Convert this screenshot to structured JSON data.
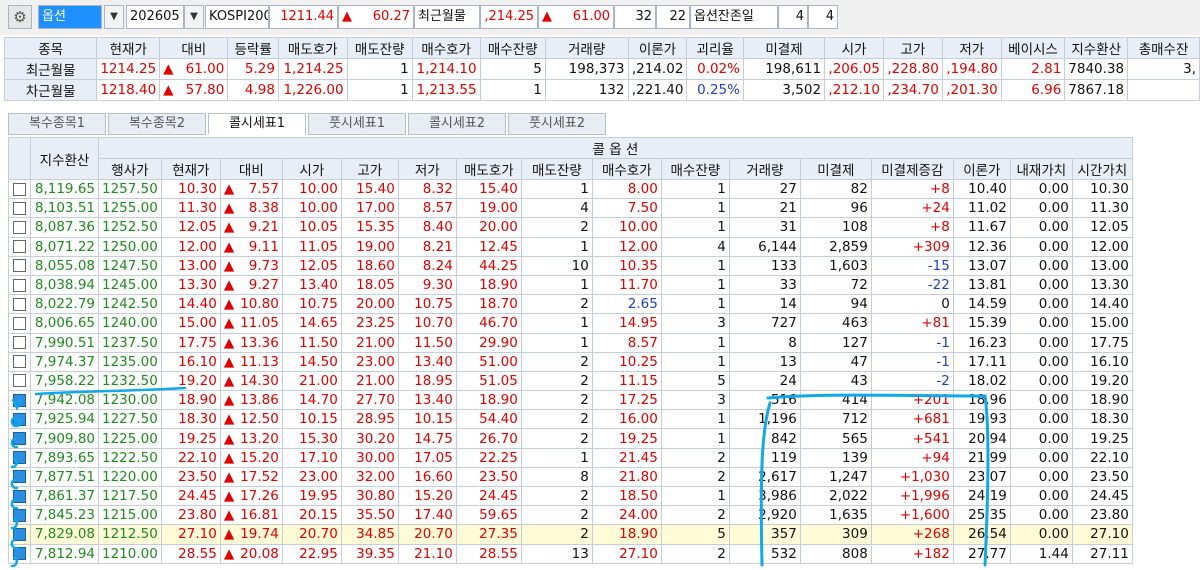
{
  "toolbar": {
    "option_type": "옵션",
    "expiry": "202605",
    "index_name": "KOSPI200",
    "index_price": "1211.44",
    "index_change": "60.27",
    "front_label": "최근월물",
    "front_price": ",214.25",
    "front_change": "61.00",
    "count_a": "32",
    "count_b": "22",
    "days_label": "옵션잔존일",
    "days_a": "4",
    "days_b": "4"
  },
  "futures": {
    "headers": [
      "종목",
      "현재가",
      "대비",
      "등락률",
      "매도호가",
      "매도잔량",
      "매수호가",
      "매수잔량",
      "거래량",
      "이론가",
      "괴리율",
      "미결제",
      "시가",
      "고가",
      "저가",
      "베이시스",
      "지수환산",
      "총매수잔"
    ],
    "rows": [
      {
        "name": "최근월물",
        "price": "1214.25",
        "change": "61.00",
        "rate": "5.29",
        "ask": "1,214.25",
        "ask_qty": "1",
        "bid": "1,214.10",
        "bid_qty": "5",
        "volume": "198,373",
        "theory": ",214.02",
        "gap": "0.02%",
        "oi": "198,611",
        "open": ",206.05",
        "high": ",228.80",
        "low": ",194.80",
        "basis": "2.81",
        "idx": "7840.38",
        "total": "3,"
      },
      {
        "name": "차근월물",
        "price": "1218.40",
        "change": "57.80",
        "rate": "4.98",
        "ask": "1,226.00",
        "ask_qty": "1",
        "bid": "1,213.55",
        "bid_qty": "1",
        "volume": "132",
        "theory": ",221.40",
        "gap": "0.25%",
        "oi": "3,502",
        "open": ",212.10",
        "high": ",234.70",
        "low": ",201.30",
        "basis": "6.96",
        "idx": "7867.18",
        "total": ""
      }
    ]
  },
  "tabs": [
    "복수종목1",
    "복수종목2",
    "콜시세표1",
    "풋시세표1",
    "콜시세표2",
    "풋시세표2"
  ],
  "calls": {
    "group_title": "콜 옵 션",
    "headers": [
      "지수환산",
      "행사가",
      "현재가",
      "대비",
      "시가",
      "고가",
      "저가",
      "매도호가",
      "매도잔량",
      "매수호가",
      "매수잔량",
      "거래량",
      "미결제",
      "미결제증감",
      "이론가",
      "내재가치",
      "시간가치"
    ],
    "rows": [
      {
        "checked": false,
        "hl": false,
        "idx": "8,119.65",
        "strike": "1257.50",
        "price": "10.30",
        "chg": "7.57",
        "open": "10.00",
        "high": "15.40",
        "low": "8.32",
        "ask": "15.40",
        "askq": "1",
        "bid": "8.00",
        "bidq": "1",
        "vol": "27",
        "oi": "82",
        "oichg": "+8",
        "theory": "10.40",
        "intr": "0.00",
        "tv": "10.30"
      },
      {
        "checked": false,
        "hl": false,
        "idx": "8,103.51",
        "strike": "1255.00",
        "price": "11.30",
        "chg": "8.38",
        "open": "10.00",
        "high": "17.00",
        "low": "8.57",
        "ask": "19.00",
        "askq": "4",
        "bid": "7.50",
        "bidq": "1",
        "vol": "21",
        "oi": "96",
        "oichg": "+24",
        "theory": "11.02",
        "intr": "0.00",
        "tv": "11.30"
      },
      {
        "checked": false,
        "hl": false,
        "idx": "8,087.36",
        "strike": "1252.50",
        "price": "12.05",
        "chg": "9.21",
        "open": "10.05",
        "high": "15.35",
        "low": "8.40",
        "ask": "20.00",
        "askq": "2",
        "bid": "10.00",
        "bidq": "1",
        "vol": "31",
        "oi": "108",
        "oichg": "+8",
        "theory": "11.67",
        "intr": "0.00",
        "tv": "12.05"
      },
      {
        "checked": false,
        "hl": false,
        "idx": "8,071.22",
        "strike": "1250.00",
        "price": "12.00",
        "chg": "9.11",
        "open": "11.05",
        "high": "19.00",
        "low": "8.21",
        "ask": "12.45",
        "askq": "1",
        "bid": "12.00",
        "bidq": "4",
        "vol": "6,144",
        "oi": "2,859",
        "oichg": "+309",
        "theory": "12.36",
        "intr": "0.00",
        "tv": "12.00"
      },
      {
        "checked": false,
        "hl": false,
        "idx": "8,055.08",
        "strike": "1247.50",
        "price": "13.00",
        "chg": "9.73",
        "open": "12.05",
        "high": "18.60",
        "low": "8.24",
        "ask": "44.25",
        "askq": "10",
        "bid": "10.35",
        "bidq": "1",
        "vol": "133",
        "oi": "1,603",
        "oichg": "-15",
        "theory": "13.07",
        "intr": "0.00",
        "tv": "13.00"
      },
      {
        "checked": false,
        "hl": false,
        "idx": "8,038.94",
        "strike": "1245.00",
        "price": "13.30",
        "chg": "9.27",
        "open": "13.40",
        "high": "18.05",
        "low": "9.30",
        "ask": "18.90",
        "askq": "1",
        "bid": "11.70",
        "bidq": "1",
        "vol": "33",
        "oi": "72",
        "oichg": "-22",
        "theory": "13.81",
        "intr": "0.00",
        "tv": "13.30"
      },
      {
        "checked": false,
        "hl": false,
        "idx": "8,022.79",
        "strike": "1242.50",
        "price": "14.40",
        "chg": "10.80",
        "open": "10.75",
        "high": "20.00",
        "low": "10.75",
        "ask": "18.70",
        "askq": "2",
        "bid": "2.65",
        "bidq": "1",
        "vol": "14",
        "oi": "94",
        "oichg": "0",
        "theory": "14.59",
        "intr": "0.00",
        "tv": "14.40"
      },
      {
        "checked": false,
        "hl": false,
        "idx": "8,006.65",
        "strike": "1240.00",
        "price": "15.00",
        "chg": "11.05",
        "open": "14.65",
        "high": "23.25",
        "low": "10.70",
        "ask": "46.70",
        "askq": "1",
        "bid": "14.95",
        "bidq": "3",
        "vol": "727",
        "oi": "463",
        "oichg": "+81",
        "theory": "15.39",
        "intr": "0.00",
        "tv": "15.00"
      },
      {
        "checked": false,
        "hl": false,
        "idx": "7,990.51",
        "strike": "1237.50",
        "price": "17.75",
        "chg": "13.36",
        "open": "11.50",
        "high": "21.00",
        "low": "11.50",
        "ask": "29.90",
        "askq": "1",
        "bid": "8.57",
        "bidq": "1",
        "vol": "8",
        "oi": "127",
        "oichg": "-1",
        "theory": "16.23",
        "intr": "0.00",
        "tv": "17.75"
      },
      {
        "checked": false,
        "hl": false,
        "idx": "7,974.37",
        "strike": "1235.00",
        "price": "16.10",
        "chg": "11.13",
        "open": "14.50",
        "high": "23.00",
        "low": "13.40",
        "ask": "51.00",
        "askq": "2",
        "bid": "10.25",
        "bidq": "1",
        "vol": "13",
        "oi": "47",
        "oichg": "-1",
        "theory": "17.11",
        "intr": "0.00",
        "tv": "16.10"
      },
      {
        "checked": false,
        "hl": false,
        "idx": "7,958.22",
        "strike": "1232.50",
        "price": "19.20",
        "chg": "14.30",
        "open": "21.00",
        "high": "21.00",
        "low": "18.95",
        "ask": "51.05",
        "askq": "2",
        "bid": "11.15",
        "bidq": "5",
        "vol": "24",
        "oi": "43",
        "oichg": "-2",
        "theory": "18.02",
        "intr": "0.00",
        "tv": "19.20"
      },
      {
        "checked": true,
        "hl": false,
        "idx": "7,942.08",
        "strike": "1230.00",
        "price": "18.90",
        "chg": "13.86",
        "open": "14.70",
        "high": "27.70",
        "low": "13.40",
        "ask": "18.90",
        "askq": "2",
        "bid": "17.25",
        "bidq": "3",
        "vol": "516",
        "oi": "414",
        "oichg": "+201",
        "theory": "18.96",
        "intr": "0.00",
        "tv": "18.90"
      },
      {
        "checked": true,
        "hl": false,
        "idx": "7,925.94",
        "strike": "1227.50",
        "price": "18.30",
        "chg": "12.50",
        "open": "10.15",
        "high": "28.95",
        "low": "10.15",
        "ask": "54.40",
        "askq": "2",
        "bid": "16.00",
        "bidq": "1",
        "vol": "1,196",
        "oi": "712",
        "oichg": "+681",
        "theory": "19.93",
        "intr": "0.00",
        "tv": "18.30"
      },
      {
        "checked": true,
        "hl": false,
        "idx": "7,909.80",
        "strike": "1225.00",
        "price": "19.25",
        "chg": "13.20",
        "open": "15.30",
        "high": "30.20",
        "low": "14.75",
        "ask": "26.70",
        "askq": "2",
        "bid": "19.25",
        "bidq": "1",
        "vol": "842",
        "oi": "565",
        "oichg": "+541",
        "theory": "20.94",
        "intr": "0.00",
        "tv": "19.25"
      },
      {
        "checked": true,
        "hl": false,
        "idx": "7,893.65",
        "strike": "1222.50",
        "price": "22.10",
        "chg": "15.20",
        "open": "17.10",
        "high": "30.00",
        "low": "17.05",
        "ask": "22.25",
        "askq": "1",
        "bid": "21.45",
        "bidq": "2",
        "vol": "119",
        "oi": "139",
        "oichg": "+94",
        "theory": "21.99",
        "intr": "0.00",
        "tv": "22.10"
      },
      {
        "checked": true,
        "hl": false,
        "idx": "7,877.51",
        "strike": "1220.00",
        "price": "23.50",
        "chg": "17.52",
        "open": "23.00",
        "high": "32.00",
        "low": "16.60",
        "ask": "23.50",
        "askq": "8",
        "bid": "21.80",
        "bidq": "2",
        "vol": "2,617",
        "oi": "1,247",
        "oichg": "+1,030",
        "theory": "23.07",
        "intr": "0.00",
        "tv": "23.50"
      },
      {
        "checked": true,
        "hl": false,
        "idx": "7,861.37",
        "strike": "1217.50",
        "price": "24.45",
        "chg": "17.26",
        "open": "19.95",
        "high": "30.80",
        "low": "15.20",
        "ask": "24.45",
        "askq": "2",
        "bid": "18.50",
        "bidq": "1",
        "vol": "3,986",
        "oi": "2,022",
        "oichg": "+1,996",
        "theory": "24.19",
        "intr": "0.00",
        "tv": "24.45"
      },
      {
        "checked": true,
        "hl": false,
        "idx": "7,845.23",
        "strike": "1215.00",
        "price": "23.80",
        "chg": "16.81",
        "open": "20.15",
        "high": "35.50",
        "low": "17.40",
        "ask": "59.65",
        "askq": "2",
        "bid": "24.00",
        "bidq": "2",
        "vol": "2,920",
        "oi": "1,635",
        "oichg": "+1,600",
        "theory": "25.35",
        "intr": "0.00",
        "tv": "23.80"
      },
      {
        "checked": true,
        "hl": true,
        "idx": "7,829.08",
        "strike": "1212.50",
        "price": "27.10",
        "chg": "19.74",
        "open": "20.70",
        "high": "34.85",
        "low": "20.70",
        "ask": "27.35",
        "askq": "2",
        "bid": "18.90",
        "bidq": "5",
        "vol": "357",
        "oi": "309",
        "oichg": "+268",
        "theory": "26.54",
        "intr": "0.00",
        "tv": "27.10"
      },
      {
        "checked": true,
        "hl": false,
        "idx": "7,812.94",
        "strike": "1210.00",
        "price": "28.55",
        "chg": "20.08",
        "open": "22.95",
        "high": "39.35",
        "low": "21.10",
        "ask": "28.55",
        "askq": "13",
        "bid": "27.10",
        "bidq": "2",
        "vol": "532",
        "oi": "808",
        "oichg": "+182",
        "theory": "27.77",
        "intr": "1.44",
        "tv": "27.11"
      }
    ]
  },
  "colors": {
    "up": "#e00000",
    "idx": "#1f8a1f",
    "down": "#1f3fcc",
    "annotation": "#10a8e8"
  },
  "icons": {
    "gear": "gear-icon",
    "dropdown": "chevron-down-icon",
    "up": "triangle-up-icon"
  }
}
